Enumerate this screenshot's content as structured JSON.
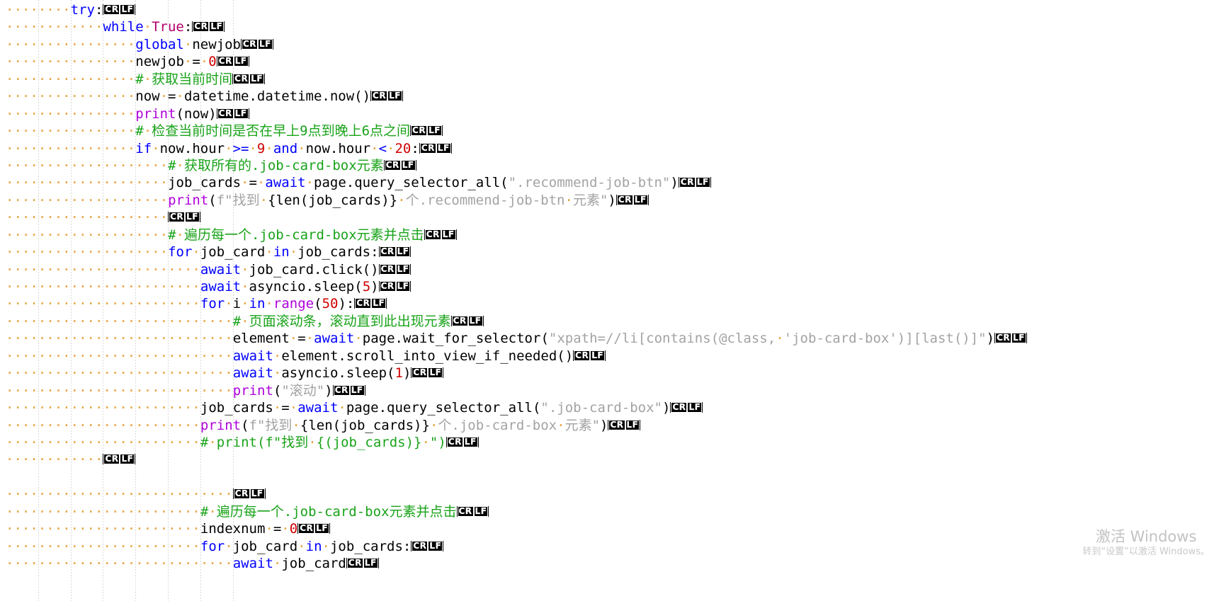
{
  "app": {
    "type": "code-editor",
    "language": "Python",
    "render_whitespace": true,
    "render_eol": true,
    "eol_label": "CRLF",
    "eol_part1": "CR",
    "eol_part2": "LF",
    "space_marker": "·",
    "colors": {
      "background": "#ffffff",
      "keyword": "#0000ff",
      "builtin_function": "#af00db",
      "constant": "#b3006b",
      "number": "#ce0000",
      "string": "#a3a3a3",
      "comment": "#19a319",
      "plain_text": "#000000",
      "whitespace_dot": "#e8a33d",
      "indent_guide": "#d8d8d8",
      "eol_badge_bg": "#000000",
      "eol_badge_fg": "#ffffff",
      "watermark": "#c8c8c8"
    }
  },
  "watermark": {
    "title": "激活 Windows",
    "subtitle": "转到“设置”以激活 Windows。"
  },
  "code": {
    "lines": [
      {
        "n": 1,
        "indent_spaces": 8,
        "eol": true,
        "tokens": [
          {
            "t": "try",
            "c": "kw"
          },
          {
            "t": ":",
            "c": "op"
          }
        ]
      },
      {
        "n": 2,
        "indent_spaces": 12,
        "eol": true,
        "tokens": [
          {
            "t": "while",
            "c": "kw"
          },
          {
            "t": " ",
            "c": "sp"
          },
          {
            "t": "True",
            "c": "const"
          },
          {
            "t": ":",
            "c": "op"
          }
        ]
      },
      {
        "n": 3,
        "indent_spaces": 16,
        "eol": true,
        "tokens": [
          {
            "t": "global",
            "c": "kw"
          },
          {
            "t": " ",
            "c": "sp"
          },
          {
            "t": "newjob",
            "c": "plain"
          }
        ]
      },
      {
        "n": 4,
        "indent_spaces": 16,
        "eol": true,
        "tokens": [
          {
            "t": "newjob",
            "c": "plain"
          },
          {
            "t": " ",
            "c": "sp"
          },
          {
            "t": "=",
            "c": "op"
          },
          {
            "t": " ",
            "c": "sp"
          },
          {
            "t": "0",
            "c": "num"
          }
        ]
      },
      {
        "n": 5,
        "indent_spaces": 16,
        "eol": true,
        "tokens": [
          {
            "t": "#",
            "c": "cmt"
          },
          {
            "t": " ",
            "c": "sp"
          },
          {
            "t": "获取当前时间",
            "c": "cmt"
          }
        ]
      },
      {
        "n": 6,
        "indent_spaces": 16,
        "eol": true,
        "tokens": [
          {
            "t": "now",
            "c": "plain"
          },
          {
            "t": " ",
            "c": "sp"
          },
          {
            "t": "=",
            "c": "op"
          },
          {
            "t": " ",
            "c": "sp"
          },
          {
            "t": "datetime.datetime.now()",
            "c": "plain"
          }
        ]
      },
      {
        "n": 7,
        "indent_spaces": 16,
        "eol": true,
        "tokens": [
          {
            "t": "print",
            "c": "kw2"
          },
          {
            "t": "(now)",
            "c": "plain"
          }
        ]
      },
      {
        "n": 8,
        "indent_spaces": 16,
        "eol": true,
        "tokens": [
          {
            "t": "#",
            "c": "cmt"
          },
          {
            "t": " ",
            "c": "sp"
          },
          {
            "t": "检查当前时间是否在早上9点到晚上6点之间",
            "c": "cmt"
          }
        ]
      },
      {
        "n": 9,
        "indent_spaces": 16,
        "eol": true,
        "tokens": [
          {
            "t": "if",
            "c": "kw"
          },
          {
            "t": " ",
            "c": "sp"
          },
          {
            "t": "now.hour",
            "c": "plain"
          },
          {
            "t": " ",
            "c": "sp"
          },
          {
            "t": ">=",
            "c": "kw"
          },
          {
            "t": " ",
            "c": "sp"
          },
          {
            "t": "9",
            "c": "num"
          },
          {
            "t": " ",
            "c": "sp"
          },
          {
            "t": "and",
            "c": "kw"
          },
          {
            "t": " ",
            "c": "sp"
          },
          {
            "t": "now.hour",
            "c": "plain"
          },
          {
            "t": " ",
            "c": "sp"
          },
          {
            "t": "<",
            "c": "kw"
          },
          {
            "t": " ",
            "c": "sp"
          },
          {
            "t": "20",
            "c": "num"
          },
          {
            "t": ":",
            "c": "op"
          }
        ]
      },
      {
        "n": 10,
        "indent_spaces": 20,
        "eol": true,
        "tokens": [
          {
            "t": "#",
            "c": "cmt"
          },
          {
            "t": " ",
            "c": "sp"
          },
          {
            "t": "获取所有的.job-card-box元素",
            "c": "cmt"
          }
        ]
      },
      {
        "n": 11,
        "indent_spaces": 20,
        "eol": true,
        "tokens": [
          {
            "t": "job_cards",
            "c": "plain"
          },
          {
            "t": " ",
            "c": "sp"
          },
          {
            "t": "=",
            "c": "op"
          },
          {
            "t": " ",
            "c": "sp"
          },
          {
            "t": "await",
            "c": "kw"
          },
          {
            "t": " ",
            "c": "sp"
          },
          {
            "t": "page.query_selector_all(",
            "c": "plain"
          },
          {
            "t": "\".recommend-job-btn\"",
            "c": "str"
          },
          {
            "t": ")",
            "c": "plain"
          }
        ]
      },
      {
        "n": 12,
        "indent_spaces": 20,
        "eol": true,
        "tokens": [
          {
            "t": "print",
            "c": "kw2"
          },
          {
            "t": "(",
            "c": "plain"
          },
          {
            "t": "f\"找到",
            "c": "str"
          },
          {
            "t": " ",
            "c": "sp"
          },
          {
            "t": "{",
            "c": "brc"
          },
          {
            "t": "len",
            "c": "plain"
          },
          {
            "t": "(job_cards)",
            "c": "plain"
          },
          {
            "t": "}",
            "c": "brc"
          },
          {
            "t": " ",
            "c": "sp"
          },
          {
            "t": "个.recommend-job-btn",
            "c": "str"
          },
          {
            "t": " ",
            "c": "sp"
          },
          {
            "t": "元素\"",
            "c": "str"
          },
          {
            "t": ")",
            "c": "plain"
          }
        ]
      },
      {
        "n": 13,
        "indent_spaces": 20,
        "eol": true,
        "tokens": []
      },
      {
        "n": 14,
        "indent_spaces": 20,
        "eol": true,
        "tokens": [
          {
            "t": "#",
            "c": "cmt"
          },
          {
            "t": " ",
            "c": "sp"
          },
          {
            "t": "遍历每一个.job-card-box元素并点击",
            "c": "cmt"
          }
        ]
      },
      {
        "n": 15,
        "indent_spaces": 20,
        "eol": true,
        "tokens": [
          {
            "t": "for",
            "c": "kw"
          },
          {
            "t": " ",
            "c": "sp"
          },
          {
            "t": "job_card",
            "c": "plain"
          },
          {
            "t": " ",
            "c": "sp"
          },
          {
            "t": "in",
            "c": "kw"
          },
          {
            "t": " ",
            "c": "sp"
          },
          {
            "t": "job_cards",
            "c": "plain"
          },
          {
            "t": ":",
            "c": "op"
          }
        ]
      },
      {
        "n": 16,
        "indent_spaces": 24,
        "eol": true,
        "tokens": [
          {
            "t": "await",
            "c": "kw"
          },
          {
            "t": " ",
            "c": "sp"
          },
          {
            "t": "job_card.click()",
            "c": "plain"
          }
        ]
      },
      {
        "n": 17,
        "indent_spaces": 24,
        "eol": true,
        "tokens": [
          {
            "t": "await",
            "c": "kw"
          },
          {
            "t": " ",
            "c": "sp"
          },
          {
            "t": "asyncio.sleep(",
            "c": "plain"
          },
          {
            "t": "5",
            "c": "num"
          },
          {
            "t": ")",
            "c": "plain"
          }
        ]
      },
      {
        "n": 18,
        "indent_spaces": 24,
        "eol": true,
        "tokens": [
          {
            "t": "for",
            "c": "kw"
          },
          {
            "t": " ",
            "c": "sp"
          },
          {
            "t": "i",
            "c": "plain"
          },
          {
            "t": " ",
            "c": "sp"
          },
          {
            "t": "in",
            "c": "kw"
          },
          {
            "t": " ",
            "c": "sp"
          },
          {
            "t": "range",
            "c": "kw2"
          },
          {
            "t": "(",
            "c": "plain"
          },
          {
            "t": "50",
            "c": "num"
          },
          {
            "t": "):",
            "c": "plain"
          }
        ]
      },
      {
        "n": 19,
        "indent_spaces": 28,
        "eol": true,
        "tokens": [
          {
            "t": "#",
            "c": "cmt"
          },
          {
            "t": " ",
            "c": "sp"
          },
          {
            "t": "页面滚动条，滚动直到此出现元素",
            "c": "cmt"
          }
        ]
      },
      {
        "n": 20,
        "indent_spaces": 28,
        "eol": true,
        "tokens": [
          {
            "t": "element",
            "c": "plain"
          },
          {
            "t": " ",
            "c": "sp"
          },
          {
            "t": "=",
            "c": "op"
          },
          {
            "t": " ",
            "c": "sp"
          },
          {
            "t": "await",
            "c": "kw"
          },
          {
            "t": " ",
            "c": "sp"
          },
          {
            "t": "page.wait_for_selector(",
            "c": "plain"
          },
          {
            "t": "\"xpath=//li[contains(@class,",
            "c": "str"
          },
          {
            "t": " ",
            "c": "sp"
          },
          {
            "t": "'job-card-box')][last()]\"",
            "c": "str"
          },
          {
            "t": ")",
            "c": "plain"
          }
        ]
      },
      {
        "n": 21,
        "indent_spaces": 28,
        "eol": true,
        "tokens": [
          {
            "t": "await",
            "c": "kw"
          },
          {
            "t": " ",
            "c": "sp"
          },
          {
            "t": "element.scroll_into_view_if_needed()",
            "c": "plain"
          }
        ]
      },
      {
        "n": 22,
        "indent_spaces": 28,
        "eol": true,
        "tokens": [
          {
            "t": "await",
            "c": "kw"
          },
          {
            "t": " ",
            "c": "sp"
          },
          {
            "t": "asyncio.sleep(",
            "c": "plain"
          },
          {
            "t": "1",
            "c": "num"
          },
          {
            "t": ")",
            "c": "plain"
          }
        ]
      },
      {
        "n": 23,
        "indent_spaces": 28,
        "eol": true,
        "tokens": [
          {
            "t": "print",
            "c": "kw2"
          },
          {
            "t": "(",
            "c": "plain"
          },
          {
            "t": "\"滚动\"",
            "c": "str"
          },
          {
            "t": ")",
            "c": "plain"
          }
        ]
      },
      {
        "n": 24,
        "indent_spaces": 24,
        "eol": true,
        "tokens": [
          {
            "t": "job_cards",
            "c": "plain"
          },
          {
            "t": " ",
            "c": "sp"
          },
          {
            "t": "=",
            "c": "op"
          },
          {
            "t": " ",
            "c": "sp"
          },
          {
            "t": "await",
            "c": "kw"
          },
          {
            "t": " ",
            "c": "sp"
          },
          {
            "t": "page.query_selector_all(",
            "c": "plain"
          },
          {
            "t": "\".job-card-box\"",
            "c": "str"
          },
          {
            "t": ")",
            "c": "plain"
          }
        ]
      },
      {
        "n": 25,
        "indent_spaces": 24,
        "eol": true,
        "tokens": [
          {
            "t": "print",
            "c": "kw2"
          },
          {
            "t": "(",
            "c": "plain"
          },
          {
            "t": "f\"找到",
            "c": "str"
          },
          {
            "t": " ",
            "c": "sp"
          },
          {
            "t": "{",
            "c": "brc"
          },
          {
            "t": "len",
            "c": "plain"
          },
          {
            "t": "(job_cards)",
            "c": "plain"
          },
          {
            "t": "}",
            "c": "brc"
          },
          {
            "t": " ",
            "c": "sp"
          },
          {
            "t": "个.job-card-box",
            "c": "str"
          },
          {
            "t": " ",
            "c": "sp"
          },
          {
            "t": "元素\"",
            "c": "str"
          },
          {
            "t": ")",
            "c": "plain"
          }
        ]
      },
      {
        "n": 26,
        "indent_spaces": 24,
        "eol": true,
        "tokens": [
          {
            "t": "#",
            "c": "cmt"
          },
          {
            "t": " ",
            "c": "sp"
          },
          {
            "t": "print(f\"找到",
            "c": "cmt"
          },
          {
            "t": " ",
            "c": "sp"
          },
          {
            "t": "{(job_cards)}",
            "c": "cmt"
          },
          {
            "t": " ",
            "c": "sp"
          },
          {
            "t": "\")",
            "c": "cmt"
          }
        ]
      },
      {
        "n": 27,
        "indent_spaces": 12,
        "eol": true,
        "tokens": []
      },
      {
        "n": 28,
        "indent_spaces": 0,
        "eol": false,
        "tokens": []
      },
      {
        "n": 29,
        "indent_spaces": 28,
        "eol": true,
        "tokens": []
      },
      {
        "n": 30,
        "indent_spaces": 24,
        "eol": true,
        "tokens": [
          {
            "t": "#",
            "c": "cmt"
          },
          {
            "t": " ",
            "c": "sp"
          },
          {
            "t": "遍历每一个.job-card-box元素并点击",
            "c": "cmt"
          }
        ]
      },
      {
        "n": 31,
        "indent_spaces": 24,
        "eol": true,
        "tokens": [
          {
            "t": "indexnum",
            "c": "plain"
          },
          {
            "t": " ",
            "c": "sp"
          },
          {
            "t": "=",
            "c": "op"
          },
          {
            "t": " ",
            "c": "sp"
          },
          {
            "t": "0",
            "c": "num"
          }
        ]
      },
      {
        "n": 32,
        "indent_spaces": 24,
        "eol": true,
        "tokens": [
          {
            "t": "for",
            "c": "kw"
          },
          {
            "t": " ",
            "c": "sp"
          },
          {
            "t": "job_card",
            "c": "plain"
          },
          {
            "t": " ",
            "c": "sp"
          },
          {
            "t": "in",
            "c": "kw"
          },
          {
            "t": " ",
            "c": "sp"
          },
          {
            "t": "job_cards",
            "c": "plain"
          },
          {
            "t": ":",
            "c": "op"
          }
        ]
      },
      {
        "n": 33,
        "indent_spaces": 28,
        "eol": true,
        "clipped": true,
        "tokens": [
          {
            "t": "await",
            "c": "kw"
          },
          {
            "t": " ",
            "c": "sp"
          },
          {
            "t": "job_card",
            "c": "plain"
          }
        ]
      }
    ],
    "indent_guide_columns": [
      4,
      8,
      12,
      16,
      20,
      24,
      28
    ]
  }
}
